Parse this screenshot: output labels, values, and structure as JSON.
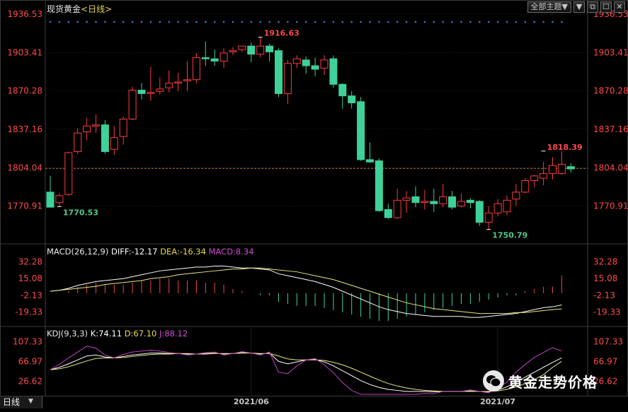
{
  "header": {
    "instrument": "现货黄金",
    "period": "<日线>",
    "dropdown_label": "全部主题▼",
    "buttons": [
      "▼",
      "⧉",
      "☐",
      "✕"
    ]
  },
  "chart_data": [
    {
      "type": "candlestick",
      "title": "现货黄金",
      "ylim": [
        1750,
        1936.53
      ],
      "y_ticks": [
        1936.53,
        1903.41,
        1870.28,
        1837.16,
        1804.04,
        1770.91
      ],
      "x_tick_labels": [
        "2021/06",
        "2021/07"
      ],
      "x_tick_index": [
        22,
        49
      ],
      "current_price_line": 1803.5,
      "annotations": [
        {
          "label": "1916.63",
          "value": 1916.63,
          "index": 23,
          "color": "#ff4a4a"
        },
        {
          "label": "1770.53",
          "value": 1770.53,
          "index": 1,
          "color": "#4ec98a"
        },
        {
          "label": "1750.79",
          "value": 1750.79,
          "index": 48,
          "color": "#4ec98a"
        },
        {
          "label": "1818.39",
          "value": 1818.39,
          "index": 54,
          "color": "#ff4a4a"
        }
      ],
      "colors": {
        "up": "#ff3b3b",
        "down": "#3ed19a",
        "grid": "#2a2a2a",
        "axis_text": "#ff4a4a",
        "price_line": "#c8732e"
      },
      "candles": [
        {
          "o": 1783,
          "h": 1797,
          "c": 1770,
          "l": 1770.5
        },
        {
          "o": 1774,
          "h": 1782,
          "c": 1780,
          "l": 1770.5
        },
        {
          "o": 1781,
          "h": 1818,
          "c": 1817,
          "l": 1780
        },
        {
          "o": 1818,
          "h": 1838,
          "c": 1834,
          "l": 1816
        },
        {
          "o": 1835,
          "h": 1847,
          "c": 1840,
          "l": 1828
        },
        {
          "o": 1840,
          "h": 1850,
          "c": 1841,
          "l": 1834
        },
        {
          "o": 1841,
          "h": 1845,
          "c": 1818,
          "l": 1816
        },
        {
          "o": 1820,
          "h": 1840,
          "c": 1830,
          "l": 1815
        },
        {
          "o": 1831,
          "h": 1848,
          "c": 1846,
          "l": 1824
        },
        {
          "o": 1846,
          "h": 1874,
          "c": 1871,
          "l": 1845
        },
        {
          "o": 1871,
          "h": 1877,
          "c": 1868,
          "l": 1863
        },
        {
          "o": 1869,
          "h": 1891,
          "c": 1869,
          "l": 1862
        },
        {
          "o": 1870,
          "h": 1882,
          "c": 1872,
          "l": 1867
        },
        {
          "o": 1873,
          "h": 1888,
          "c": 1877,
          "l": 1869
        },
        {
          "o": 1878,
          "h": 1886,
          "c": 1878,
          "l": 1870
        },
        {
          "o": 1879,
          "h": 1896,
          "c": 1880,
          "l": 1870
        },
        {
          "o": 1880,
          "h": 1903,
          "c": 1899,
          "l": 1877
        },
        {
          "o": 1899,
          "h": 1913,
          "c": 1898,
          "l": 1892
        },
        {
          "o": 1898,
          "h": 1906,
          "c": 1896,
          "l": 1892
        },
        {
          "o": 1896,
          "h": 1907,
          "c": 1903,
          "l": 1890
        },
        {
          "o": 1904,
          "h": 1908,
          "c": 1905,
          "l": 1901
        },
        {
          "o": 1906,
          "h": 1909,
          "c": 1909,
          "l": 1904
        },
        {
          "o": 1909,
          "h": 1912,
          "c": 1902,
          "l": 1895
        },
        {
          "o": 1902,
          "h": 1916.63,
          "c": 1909,
          "l": 1899
        },
        {
          "o": 1909,
          "h": 1911,
          "c": 1904,
          "l": 1896
        },
        {
          "o": 1905,
          "h": 1907,
          "c": 1868,
          "l": 1865
        },
        {
          "o": 1868,
          "h": 1897,
          "c": 1894,
          "l": 1859
        },
        {
          "o": 1894,
          "h": 1901,
          "c": 1898,
          "l": 1890
        },
        {
          "o": 1897,
          "h": 1900,
          "c": 1892,
          "l": 1885
        },
        {
          "o": 1892,
          "h": 1899,
          "c": 1889,
          "l": 1883
        },
        {
          "o": 1890,
          "h": 1901,
          "c": 1897,
          "l": 1884
        },
        {
          "o": 1898,
          "h": 1901,
          "c": 1876,
          "l": 1873
        },
        {
          "o": 1876,
          "h": 1877,
          "c": 1866,
          "l": 1855
        },
        {
          "o": 1866,
          "h": 1870,
          "c": 1860,
          "l": 1855
        },
        {
          "o": 1861,
          "h": 1865,
          "c": 1811,
          "l": 1810
        },
        {
          "o": 1811,
          "h": 1826,
          "c": 1809,
          "l": 1808
        },
        {
          "o": 1810,
          "h": 1812,
          "c": 1767,
          "l": 1766
        },
        {
          "o": 1768,
          "h": 1773,
          "c": 1761,
          "l": 1760
        },
        {
          "o": 1761,
          "h": 1786,
          "c": 1776,
          "l": 1760
        },
        {
          "o": 1776,
          "h": 1784,
          "c": 1778,
          "l": 1765
        },
        {
          "o": 1779,
          "h": 1788,
          "c": 1774,
          "l": 1770
        },
        {
          "o": 1775,
          "h": 1785,
          "c": 1775,
          "l": 1768
        },
        {
          "o": 1775,
          "h": 1786,
          "c": 1773,
          "l": 1766
        },
        {
          "o": 1773,
          "h": 1790,
          "c": 1779,
          "l": 1770
        },
        {
          "o": 1779,
          "h": 1784,
          "c": 1770,
          "l": 1768
        },
        {
          "o": 1771,
          "h": 1782,
          "c": 1775,
          "l": 1770
        },
        {
          "o": 1776,
          "h": 1778,
          "c": 1774,
          "l": 1769
        },
        {
          "o": 1775,
          "h": 1776,
          "c": 1757,
          "l": 1754
        },
        {
          "o": 1757,
          "h": 1771,
          "c": 1765,
          "l": 1750.79
        },
        {
          "o": 1765,
          "h": 1777,
          "c": 1773,
          "l": 1762
        },
        {
          "o": 1766,
          "h": 1780,
          "c": 1776,
          "l": 1763
        },
        {
          "o": 1777,
          "h": 1790,
          "c": 1783,
          "l": 1771
        },
        {
          "o": 1783,
          "h": 1795,
          "c": 1793,
          "l": 1782
        },
        {
          "o": 1793,
          "h": 1798,
          "c": 1797,
          "l": 1787
        },
        {
          "o": 1795,
          "h": 1809,
          "c": 1799,
          "l": 1789
        },
        {
          "o": 1799,
          "h": 1813,
          "c": 1806,
          "l": 1794
        },
        {
          "o": 1799,
          "h": 1818.39,
          "c": 1807,
          "l": 1798
        },
        {
          "o": 1805,
          "h": 1808,
          "c": 1803,
          "l": 1800
        }
      ]
    },
    {
      "type": "line",
      "title": "MACD(26,12,9)",
      "labels": {
        "diff": "DIFF:-12.17",
        "dea": "DEA:-16.34",
        "macd": "MACD:8.34"
      },
      "ylim": [
        -30,
        40
      ],
      "y_ticks": [
        32.28,
        15.08,
        -2.13,
        -19.33
      ],
      "series": [
        {
          "name": "DIFF",
          "color": "#ffffff",
          "values": [
            2,
            3,
            5,
            8,
            10,
            12,
            13,
            14,
            15,
            17,
            19,
            21,
            23,
            24,
            25,
            26,
            27,
            27,
            28,
            28,
            27,
            26,
            26,
            25,
            24,
            20,
            18,
            16,
            14,
            12,
            9,
            6,
            2,
            -2,
            -6,
            -10,
            -14,
            -17,
            -19,
            -21,
            -22,
            -23,
            -24,
            -24,
            -24,
            -24,
            -25,
            -25,
            -24,
            -23,
            -22,
            -21,
            -19,
            -17,
            -15,
            -14,
            -12.17
          ]
        },
        {
          "name": "DEA",
          "color": "#e9ea7b",
          "values": [
            2,
            3,
            4,
            5,
            6,
            7,
            9,
            10,
            11,
            12,
            13,
            15,
            16,
            17,
            19,
            20,
            21,
            22,
            23,
            24,
            25,
            25,
            26,
            26,
            25,
            24,
            23,
            22,
            20,
            18,
            16,
            14,
            11,
            8,
            5,
            2,
            -1,
            -4,
            -7,
            -10,
            -12,
            -14,
            -16,
            -17,
            -18,
            -19,
            -20,
            -21,
            -21,
            -21,
            -21,
            -20,
            -20,
            -19,
            -18,
            -17,
            -16.34
          ]
        },
        {
          "name": "MACD",
          "color": "#e84a4a",
          "values": [
            0,
            0,
            1,
            3,
            4,
            5,
            4,
            4,
            4,
            5,
            6,
            6,
            7,
            7,
            6,
            6,
            6,
            5,
            5,
            4,
            2,
            1,
            0,
            -1,
            -1,
            -4,
            -5,
            -6,
            -6,
            -6,
            -7,
            -8,
            -9,
            -10,
            -11,
            -12,
            -13,
            -13,
            -12,
            -11,
            -10,
            -9,
            -8,
            -7,
            -6,
            -5,
            -5,
            -4,
            -3,
            -2,
            -1,
            -1,
            1,
            2,
            3,
            3,
            8.34
          ]
        }
      ]
    },
    {
      "type": "line",
      "title": "KDJ(9,3,3)",
      "labels": {
        "k": "K:74.11",
        "d": "D:67.10",
        "j": "J:88.12"
      },
      "ylim": [
        0,
        115
      ],
      "y_ticks": [
        107.33,
        66.97,
        26.62
      ],
      "series": [
        {
          "name": "K",
          "color": "#ffffff",
          "values": [
            50,
            55,
            62,
            70,
            78,
            80,
            76,
            74,
            77,
            80,
            82,
            84,
            84,
            83,
            83,
            82,
            82,
            83,
            84,
            82,
            83,
            85,
            84,
            82,
            84,
            67,
            62,
            66,
            70,
            71,
            66,
            58,
            48,
            38,
            28,
            20,
            14,
            10,
            8,
            6,
            6,
            6,
            5,
            6,
            6,
            6,
            7,
            6,
            5,
            9,
            15,
            25,
            35,
            45,
            55,
            65,
            74.11
          ]
        },
        {
          "name": "D",
          "color": "#e9ea7b",
          "values": [
            50,
            52,
            56,
            62,
            68,
            73,
            74,
            74,
            75,
            77,
            79,
            81,
            82,
            82,
            83,
            83,
            82,
            82,
            83,
            83,
            83,
            84,
            84,
            83,
            83,
            78,
            72,
            70,
            70,
            70,
            69,
            65,
            60,
            53,
            45,
            37,
            29,
            22,
            17,
            13,
            10,
            8,
            7,
            6,
            6,
            6,
            6,
            6,
            6,
            7,
            10,
            15,
            22,
            30,
            40,
            55,
            67.1
          ]
        },
        {
          "name": "J",
          "color": "#c241c6",
          "values": [
            50,
            61,
            74,
            86,
            98,
            94,
            80,
            74,
            81,
            86,
            88,
            90,
            88,
            85,
            83,
            80,
            82,
            85,
            86,
            80,
            83,
            87,
            84,
            80,
            86,
            45,
            42,
            58,
            70,
            73,
            60,
            44,
            24,
            8,
            0,
            0,
            0,
            0,
            0,
            0,
            0,
            2,
            1,
            6,
            6,
            6,
            9,
            6,
            3,
            13,
            25,
            45,
            61,
            75,
            85,
            95,
            88.12
          ]
        }
      ]
    }
  ]
}
